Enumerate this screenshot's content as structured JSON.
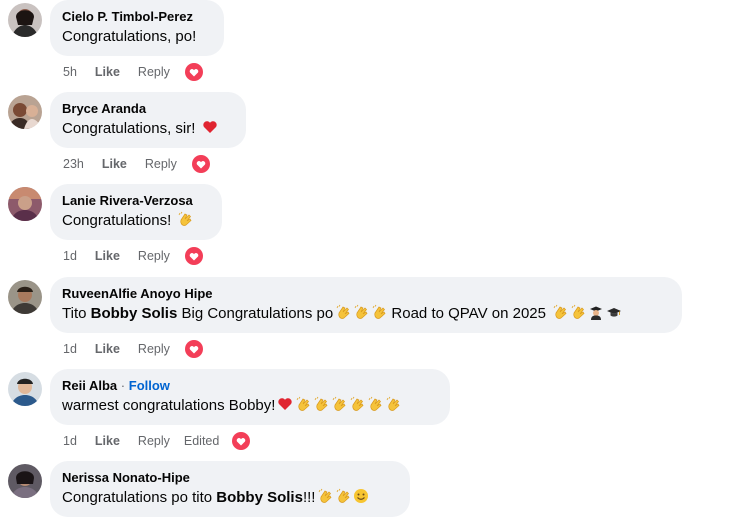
{
  "colors": {
    "bubble": "#f0f2f5",
    "meta": "#65676b",
    "follow": "#0064d1",
    "love": "#f33e58"
  },
  "comments": [
    {
      "author": "Cielo P. Timbol-Perez",
      "parts": [
        {
          "t": "Congratulations, po!"
        }
      ],
      "time": "5h",
      "like": "Like",
      "reply": "Reply",
      "reaction": "love-reaction-icon"
    },
    {
      "author": "Bryce Aranda",
      "parts": [
        {
          "t": "Congratulations, sir! "
        },
        {
          "e": "heart"
        }
      ],
      "time": "23h",
      "like": "Like",
      "reply": "Reply",
      "reaction": "love-reaction-icon"
    },
    {
      "author": "Lanie Rivera-Verzosa",
      "parts": [
        {
          "t": "Congratulations! "
        },
        {
          "e": "clap"
        }
      ],
      "time": "1d",
      "like": "Like",
      "reply": "Reply",
      "reaction": "love-reaction-icon"
    },
    {
      "author": "RuveenAlfie Anoyo Hipe",
      "parts": [
        {
          "t": "Tito "
        },
        {
          "b": "Bobby Solis"
        },
        {
          "t": " Big Congratulations po"
        },
        {
          "e": "clap"
        },
        {
          "e": "clap"
        },
        {
          "e": "clap"
        },
        {
          "t": " Road to QPAV on 2025 "
        },
        {
          "e": "clap"
        },
        {
          "e": "clap"
        },
        {
          "e": "graduate"
        },
        {
          "e": "cap"
        }
      ],
      "time": "1d",
      "like": "Like",
      "reply": "Reply",
      "reaction": "love-reaction-icon"
    },
    {
      "author": "Reii Alba",
      "follow": "Follow",
      "separator": "·",
      "parts": [
        {
          "t": "warmest congratulations Bobby!"
        },
        {
          "e": "heart"
        },
        {
          "e": "clap"
        },
        {
          "e": "clap"
        },
        {
          "e": "clap"
        },
        {
          "e": "clap"
        },
        {
          "e": "clap"
        },
        {
          "e": "clap"
        }
      ],
      "time": "1d",
      "like": "Like",
      "reply": "Reply",
      "edited": "Edited",
      "reaction": "love-reaction-icon"
    },
    {
      "author": "Nerissa Nonato-Hipe",
      "parts": [
        {
          "t": "Congratulations po tito "
        },
        {
          "b": "Bobby Solis"
        },
        {
          "t": "!!!"
        },
        {
          "e": "clap"
        },
        {
          "e": "clap"
        },
        {
          "e": "smile"
        }
      ],
      "time": "1d",
      "like": "Like",
      "reply": "Reply"
    }
  ]
}
